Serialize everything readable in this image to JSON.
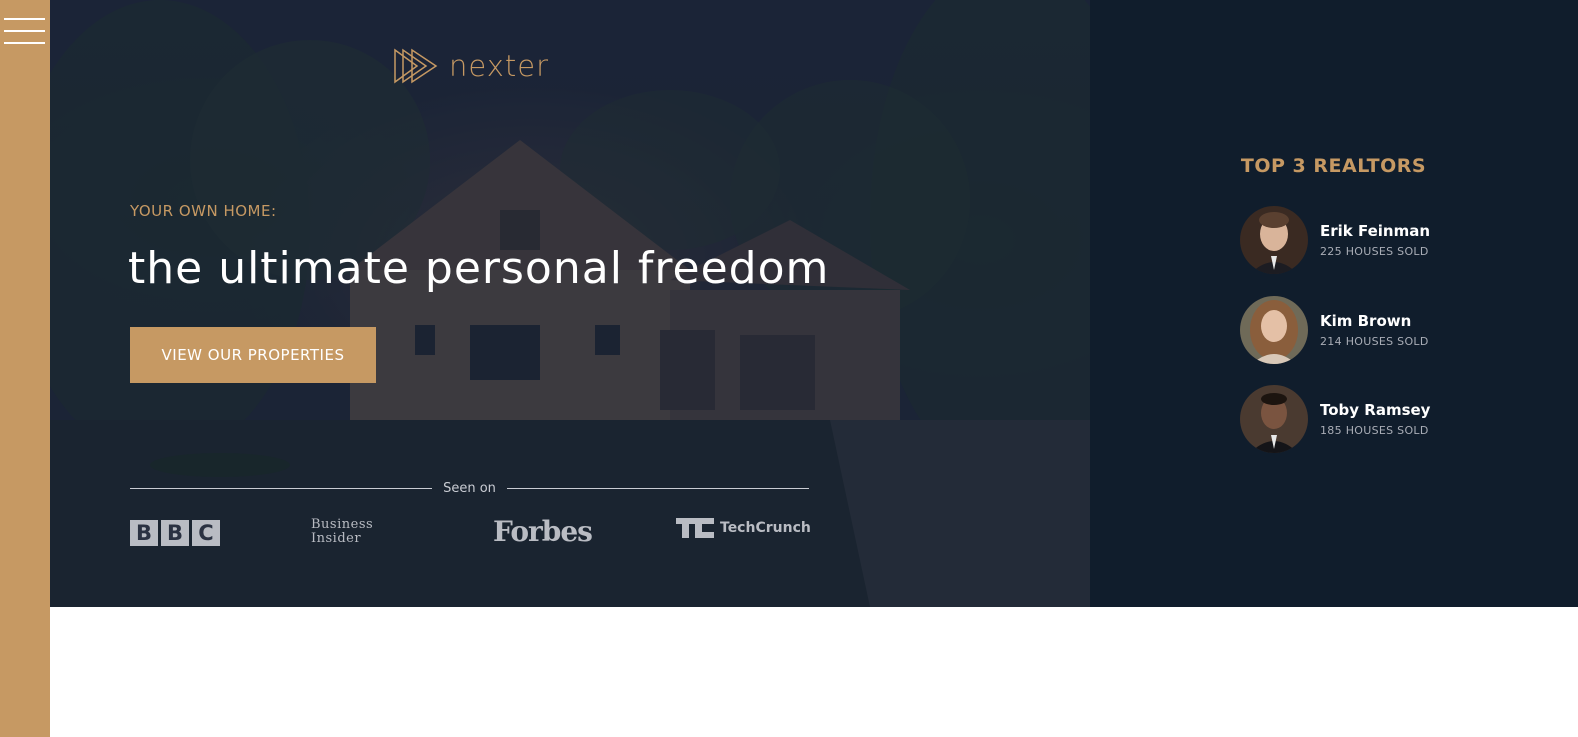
{
  "sidebar": {
    "menu_icon": "hamburger-menu-icon",
    "bg_color": "#c69963"
  },
  "header": {
    "logo": {
      "icon": "triple-play-logo-icon",
      "text": "nexter"
    },
    "subtitle": "YOUR OWN HOME:",
    "headline": "the ultimate personal freedom",
    "cta_label": "VIEW OUR PROPERTIES",
    "seen_on_label": "Seen on",
    "press_logos": {
      "bbc": [
        "B",
        "B",
        "C"
      ],
      "business_insider": [
        "Business",
        "Insider"
      ],
      "forbes": "Forbes",
      "techcrunch": "TechCrunch"
    }
  },
  "realtors": {
    "title": "TOP 3 REALTORS",
    "items": [
      {
        "name": "Erik Feinman",
        "sold": "225 HOUSES SOLD"
      },
      {
        "name": "Kim Brown",
        "sold": "214 HOUSES SOLD"
      },
      {
        "name": "Toby Ramsey",
        "sold": "185 HOUSES SOLD"
      }
    ]
  },
  "colors": {
    "accent": "#c69963",
    "dark": "#101d2c",
    "white": "#ffffff"
  }
}
